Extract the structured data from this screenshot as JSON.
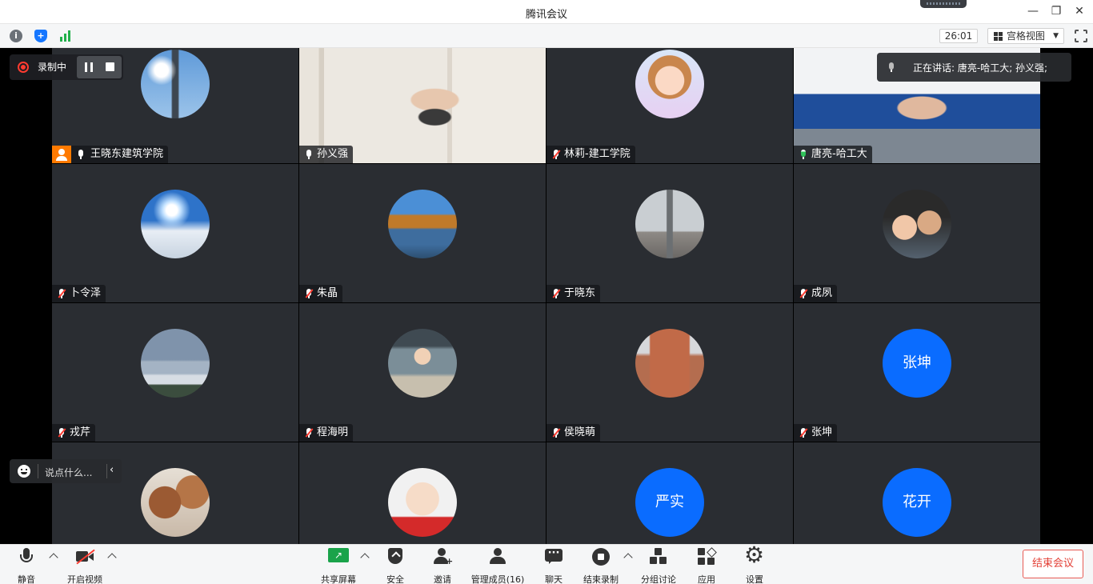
{
  "window": {
    "title": "腾讯会议",
    "minimize": "—",
    "restore": "❐",
    "close": "✕"
  },
  "subbar": {
    "timer": "26:01",
    "view_label": "宫格视图",
    "view_caret": "▼"
  },
  "recording": {
    "label": "录制中"
  },
  "speaking": {
    "text": "正在讲话: 唐亮-哈工大; 孙义强;"
  },
  "chat": {
    "placeholder": "说点什么...",
    "collapse": "‹"
  },
  "participants": [
    {
      "name": "王晓东建筑学院",
      "host": true,
      "mic": "on",
      "avatar": "eiffel-tower-photo"
    },
    {
      "name": "孙义强",
      "mic": "on",
      "video": true
    },
    {
      "name": "林莉-建工学院",
      "mic": "muted",
      "avatar": "cartoon-girl-photo"
    },
    {
      "name": "唐亮-哈工大",
      "mic": "speaking",
      "video": true,
      "active": true
    },
    {
      "name": "卜令泽",
      "mic": "muted",
      "avatar": "sky-sun-photo"
    },
    {
      "name": "朱晶",
      "mic": "muted",
      "avatar": "lake-landscape-photo"
    },
    {
      "name": "于晓东",
      "mic": "muted",
      "avatar": "monument-square-photo"
    },
    {
      "name": "成夙",
      "mic": "muted",
      "avatar": "family-photo"
    },
    {
      "name": "戎芹",
      "mic": "muted",
      "avatar": "misty-mountain-photo"
    },
    {
      "name": "程海明",
      "mic": "muted",
      "avatar": "anime-character-photo"
    },
    {
      "name": "侯晓萌",
      "mic": "muted",
      "avatar": "castle-photo"
    },
    {
      "name": "张坤",
      "mic": "muted",
      "avatar_text": "张坤"
    },
    {
      "name": "",
      "mic": "none",
      "avatar": "teddy-bear-photo"
    },
    {
      "name": "",
      "mic": "none",
      "avatar": "baby-photo"
    },
    {
      "name": "",
      "mic": "none",
      "avatar_text": "严实"
    },
    {
      "name": "",
      "mic": "none",
      "avatar_text": "花开"
    }
  ],
  "toolbar": {
    "mute": "静音",
    "start_video": "开启视频",
    "share_screen": "共享屏幕",
    "security": "安全",
    "invite": "邀请",
    "manage_members": "管理成员(16)",
    "chat": "聊天",
    "end_recording": "结束录制",
    "breakout": "分组讨论",
    "apps": "应用",
    "settings": "设置",
    "end_meeting": "结束会议"
  },
  "colors": {
    "accent_blue": "#0a6cff",
    "host_orange": "#ff7a00",
    "speaking_green": "#30c15a",
    "danger_red": "#e33f35"
  }
}
